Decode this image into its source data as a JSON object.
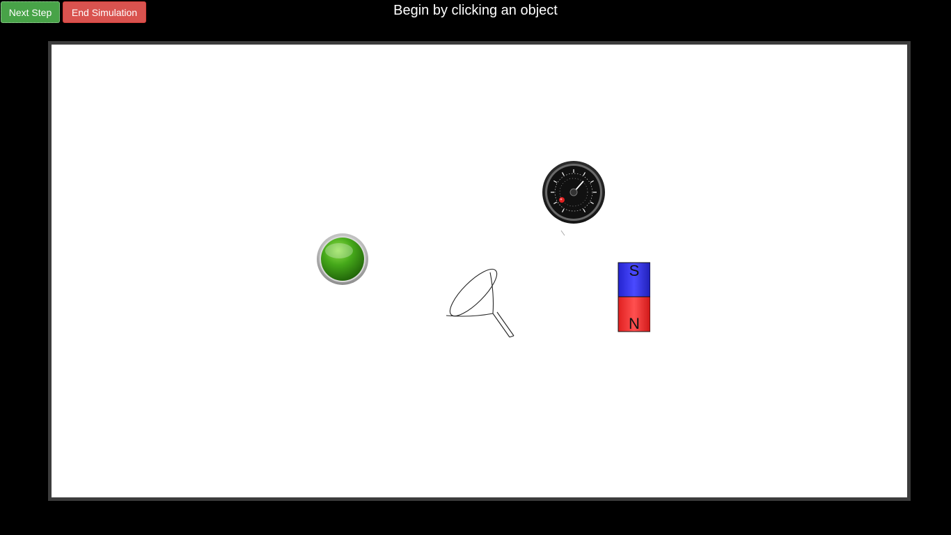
{
  "toolbar": {
    "next_label": "Next Step",
    "end_label": "End Simulation",
    "next_color": "#48a348",
    "end_color": "#d9534f"
  },
  "instruction": {
    "text": "Begin by clicking an object"
  },
  "stage": {
    "background": "#ffffff",
    "border_color": "#3c3c3c",
    "objects": [
      {
        "id": "green-button",
        "icon": "green-round-button-icon"
      },
      {
        "id": "gauge",
        "icon": "pressure-gauge-icon"
      },
      {
        "id": "funnel",
        "icon": "funnel-icon"
      },
      {
        "id": "magnet",
        "icon": "bar-magnet-icon",
        "pole_top": "S",
        "pole_bottom": "N",
        "top_color": "#3a3aff",
        "bottom_color": "#ff3a3a"
      }
    ]
  }
}
